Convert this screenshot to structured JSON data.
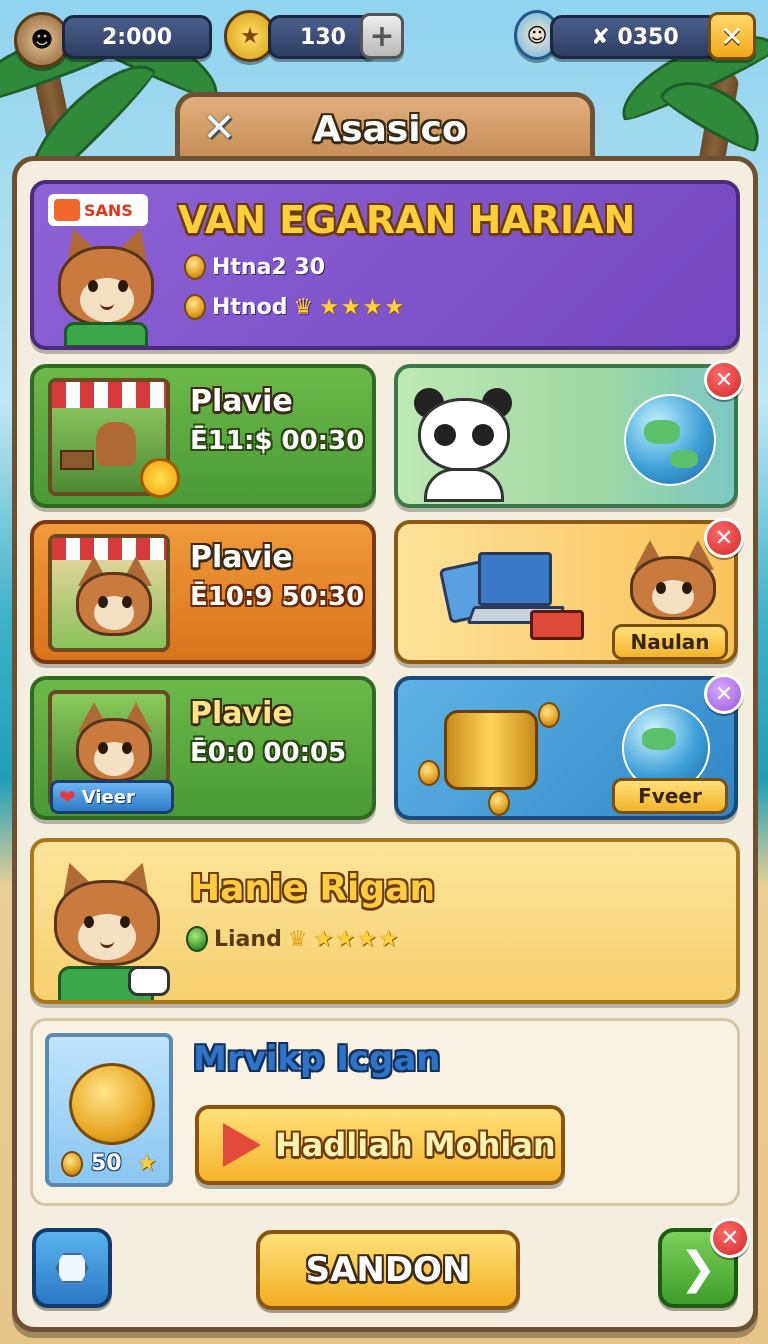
{
  "hud": {
    "currency1": "2:000",
    "currency2": "130",
    "plus_label": "+",
    "currency3": "✘ 0350",
    "close_label": "✕"
  },
  "dialog": {
    "title": "Asasico",
    "close_label": "✕"
  },
  "featured": {
    "badge": "SANS",
    "title": "VAN EGARAN HARIAN",
    "line1": "Htna2 30",
    "line2": "Htnod",
    "stars": "★★★★"
  },
  "quests": [
    {
      "title": "Plavie",
      "timer": "Ē11:$ 00:30",
      "color": "green"
    },
    {
      "title": "Plavie",
      "timer": "Ē10:9 50:30",
      "color": "orange"
    },
    {
      "title": "Plavie",
      "timer": "Ē0:0 00:05",
      "color": "green",
      "tag": "Vieer"
    }
  ],
  "rewards": [
    {
      "close": "✕"
    },
    {
      "close": "✕",
      "button": "Naulan"
    },
    {
      "close": "✕",
      "button": "Fveer"
    }
  ],
  "event": {
    "title": "Hanie Rigan",
    "line": "Liand",
    "stars": "★★★★"
  },
  "bonus": {
    "title": "Mrvikp Icgan",
    "amount": "50",
    "button": "Hadliah Mohian"
  },
  "footer": {
    "main_button": "SANDON",
    "next_label": "❯",
    "close_label": "✕"
  }
}
